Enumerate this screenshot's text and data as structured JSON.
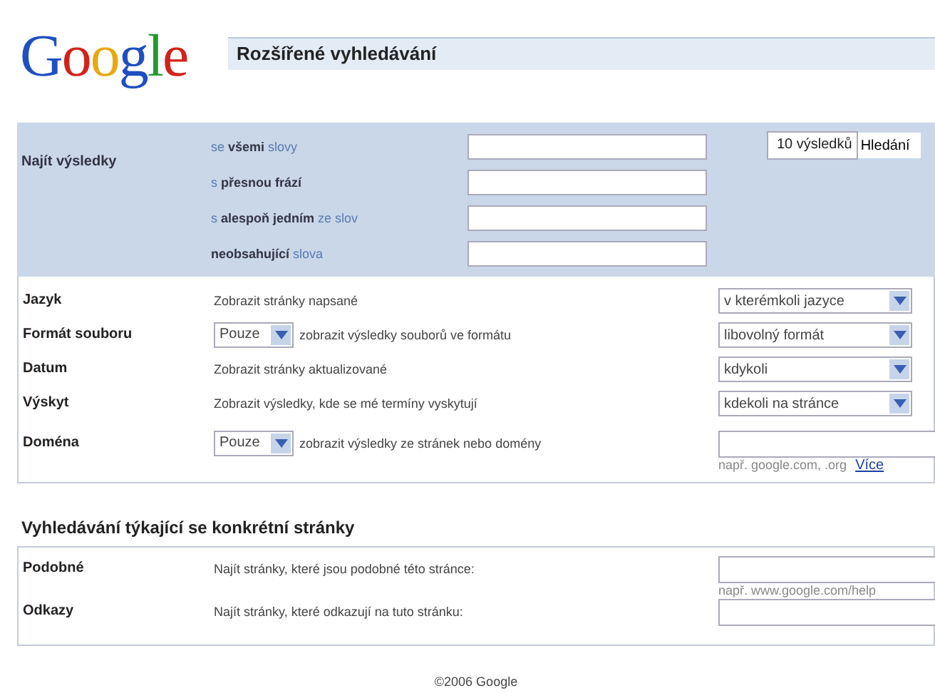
{
  "logo": "Google",
  "title": "Rozšířené vyhledávání",
  "find": {
    "label": "Najít výsledky",
    "rows": [
      {
        "label": "se **všemi** slovy",
        "value": ""
      },
      {
        "label": "s **přesnou frází**",
        "value": ""
      },
      {
        "label": "s **alespoň jedním** ze slov",
        "value": ""
      },
      {
        "label": "**neobsahující** slova",
        "value": ""
      }
    ],
    "count": "10 výsledků",
    "search_button": "Hledání"
  },
  "options": [
    {
      "label": "Jazyk",
      "kind": "text",
      "text": "Zobrazit stránky napsané",
      "dropdown": true,
      "value": "v kterémkoli jazyce"
    },
    {
      "label": "Formát souboru",
      "kind": "mode",
      "mode": "Pouze",
      "text": "zobrazit výsledky souborů ve formátu",
      "dropdown": true,
      "value": "libovolný formát"
    },
    {
      "label": "Datum",
      "kind": "text",
      "text": "Zobrazit stránky aktualizované",
      "dropdown": true,
      "value": "kdykoli"
    },
    {
      "label": "Výskyt",
      "kind": "text",
      "text": "Zobrazit výsledky, kde se mé termíny vyskytují",
      "dropdown": true,
      "value": "kdekoli na stránce"
    },
    {
      "label": "Doména",
      "kind": "mode",
      "mode": "Pouze",
      "text": "zobrazit výsledky ze stránek nebo domény",
      "dropdown": false,
      "hint": "např. google.com, .org",
      "link": "Více"
    }
  ],
  "page_section": {
    "title": "Vyhledávání týkající se konkrétní stránky",
    "rows": [
      {
        "label": "Podobné",
        "text": "Najít stránky, které jsou podobné této stránce:",
        "hint": "např. www.google.com/help"
      },
      {
        "label": "Odkazy",
        "text": "Najít stránky, které odkazují na tuto stránku:"
      }
    ]
  },
  "footer": "©2006 Google"
}
